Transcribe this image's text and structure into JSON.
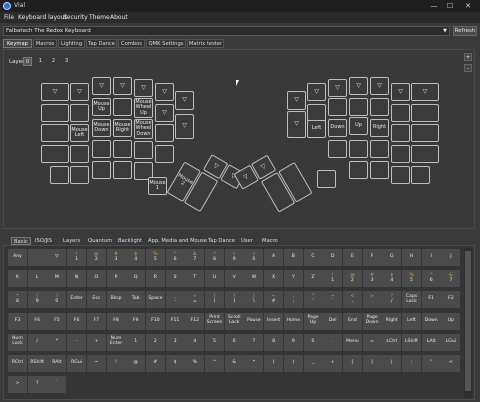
{
  "window": {
    "title": "Vial",
    "min": "—",
    "max": "☐",
    "close": "✕"
  },
  "menu": [
    "File",
    "Keyboard layout",
    "Security",
    "Theme",
    "About"
  ],
  "keyboard_select": {
    "value": "Falbatech The Redox Keyboard",
    "refresh": "Refresh"
  },
  "tabs": [
    "Keymap",
    "Macros",
    "Lighting",
    "Tap Dance",
    "Combos",
    "QMK Settings",
    "Matrix tester"
  ],
  "layer": {
    "label": "Layer",
    "items": [
      "0",
      "1",
      "2",
      "3"
    ]
  },
  "zoom": {
    "plus": "+",
    "minus": "-"
  },
  "keys": {
    "mouse_up": "Mouse\nUp",
    "mouse_wheel_up": "Mouse\nWheel\nUp",
    "mouse_left": "Mouse\nLeft",
    "mouse_down": "Mouse\nDown",
    "mouse_right": "Mouse\nRight",
    "mouse_wheel_down": "Mouse\nWheel\nDown",
    "mouse_1": "Mouse\n1",
    "mouse_2": "Mouse\n2",
    "left": "Left",
    "down": "Down",
    "up": "Up",
    "right": "Right"
  },
  "palette_tabs": [
    "Basic",
    "ISO/JIS",
    "Layers",
    "Quantum",
    "Backlight",
    "App, Media and Mouse",
    "Tap Dance",
    "User",
    "Macro"
  ],
  "palette": [
    [
      {
        "t": "Any"
      },
      {
        "t": ""
      },
      {
        "t": "▽"
      },
      {
        "u": "!",
        "b": "1"
      },
      {
        "u": "@",
        "b": "2"
      },
      {
        "u": "#",
        "b": "3"
      },
      {
        "u": "$",
        "b": "4"
      },
      {
        "u": "%",
        "b": "5"
      },
      {
        "u": "^",
        "b": "6"
      },
      {
        "u": "&",
        "b": "7"
      },
      {
        "u": "*",
        "b": "8"
      },
      {
        "u": "(",
        "b": "9"
      },
      {
        "u": ")",
        "b": "0"
      },
      {
        "t": "A"
      },
      {
        "t": "B"
      },
      {
        "t": "C"
      },
      {
        "t": "D"
      },
      {
        "t": "E"
      },
      {
        "t": "F"
      },
      {
        "t": "G"
      },
      {
        "t": "H"
      },
      {
        "t": "I"
      },
      {
        "t": "J"
      }
    ],
    [
      {
        "t": "K"
      },
      {
        "t": "L"
      },
      {
        "t": "M"
      },
      {
        "t": "N"
      },
      {
        "t": "O"
      },
      {
        "t": "P"
      },
      {
        "t": "Q"
      },
      {
        "t": "R"
      },
      {
        "t": "S"
      },
      {
        "t": "T"
      },
      {
        "t": "U"
      },
      {
        "t": "V"
      },
      {
        "t": "W"
      },
      {
        "t": "X"
      },
      {
        "t": "Y"
      },
      {
        "t": "Z"
      },
      {
        "u": "!",
        "b": "1"
      },
      {
        "u": "@",
        "b": "2"
      },
      {
        "u": "#",
        "b": "3"
      },
      {
        "u": "$",
        "b": "4"
      },
      {
        "u": "%",
        "b": "5"
      },
      {
        "u": "^",
        "b": "6"
      },
      {
        "u": "&",
        "b": "7"
      }
    ],
    [
      {
        "u": "*",
        "b": "8"
      },
      {
        "u": "(",
        "b": "9"
      },
      {
        "u": ")",
        "b": "0"
      },
      {
        "t": "Enter"
      },
      {
        "t": "Esc"
      },
      {
        "t": "Bksp"
      },
      {
        "t": "Tab"
      },
      {
        "t": "Space"
      },
      {
        "u": "_",
        "b": "-"
      },
      {
        "u": "+",
        "b": "="
      },
      {
        "u": "{",
        "b": "["
      },
      {
        "u": "}",
        "b": "]"
      },
      {
        "u": "|",
        "b": "\\"
      },
      {
        "u": "~",
        "b": "#"
      },
      {
        "u": ":",
        "b": ";"
      },
      {
        "u": "\"",
        "b": "'"
      },
      {
        "u": "~",
        "b": "`"
      },
      {
        "u": "<",
        "b": ","
      },
      {
        "u": ">",
        "b": "."
      },
      {
        "u": "?",
        "b": "/"
      },
      {
        "t": "Caps\nLock"
      },
      {
        "t": "F1"
      },
      {
        "t": "F2"
      }
    ],
    [
      {
        "t": "F3"
      },
      {
        "t": "F4"
      },
      {
        "t": "F5"
      },
      {
        "t": "F6"
      },
      {
        "t": "F7"
      },
      {
        "t": "F8"
      },
      {
        "t": "F9"
      },
      {
        "t": "F10"
      },
      {
        "t": "F11"
      },
      {
        "t": "F12"
      },
      {
        "t": "Print\nScreen"
      },
      {
        "t": "Scroll\nLock"
      },
      {
        "t": "Pause"
      },
      {
        "t": "Insert"
      },
      {
        "t": "Home"
      },
      {
        "t": "Page\nUp"
      },
      {
        "t": "Del"
      },
      {
        "t": "End"
      },
      {
        "t": "Page\nDown"
      },
      {
        "t": "Right"
      },
      {
        "t": "Left"
      },
      {
        "t": "Down"
      },
      {
        "t": "Up"
      }
    ],
    [
      {
        "t": "Num\nLock"
      },
      {
        "t": "/"
      },
      {
        "t": "*"
      },
      {
        "t": "-"
      },
      {
        "t": "+"
      },
      {
        "t": "Num\nEnter"
      },
      {
        "t": "1"
      },
      {
        "t": "2"
      },
      {
        "t": "3"
      },
      {
        "t": "4"
      },
      {
        "t": "5"
      },
      {
        "t": "6"
      },
      {
        "t": "7"
      },
      {
        "t": "8"
      },
      {
        "t": "9"
      },
      {
        "t": "0"
      },
      {
        "t": "."
      },
      {
        "t": "Menu"
      },
      {
        "t": "="
      },
      {
        "t": "LCtrl"
      },
      {
        "t": "LShift"
      },
      {
        "t": "LAlt"
      },
      {
        "t": "LGui"
      }
    ],
    [
      {
        "t": "RCtrl"
      },
      {
        "t": "RShift"
      },
      {
        "t": "RAlt"
      },
      {
        "t": "RGui"
      },
      {
        "t": "~"
      },
      {
        "t": "!"
      },
      {
        "t": "@"
      },
      {
        "t": "#"
      },
      {
        "t": "$"
      },
      {
        "t": "%"
      },
      {
        "t": "^"
      },
      {
        "t": "&"
      },
      {
        "t": "*"
      },
      {
        "t": "("
      },
      {
        "t": ")"
      },
      {
        "t": "_"
      },
      {
        "t": "+"
      },
      {
        "t": "{"
      },
      {
        "t": "}"
      },
      {
        "t": "|"
      },
      {
        "t": ":"
      },
      {
        "t": "\""
      },
      {
        "t": "<"
      }
    ],
    [
      {
        "t": ">"
      },
      {
        "t": "?"
      },
      {
        "t": "´"
      }
    ]
  ],
  "colors": {
    "shifted_legend": "#e0a050",
    "key_border": "#bdbdbd",
    "background": "#3a3a3a"
  }
}
